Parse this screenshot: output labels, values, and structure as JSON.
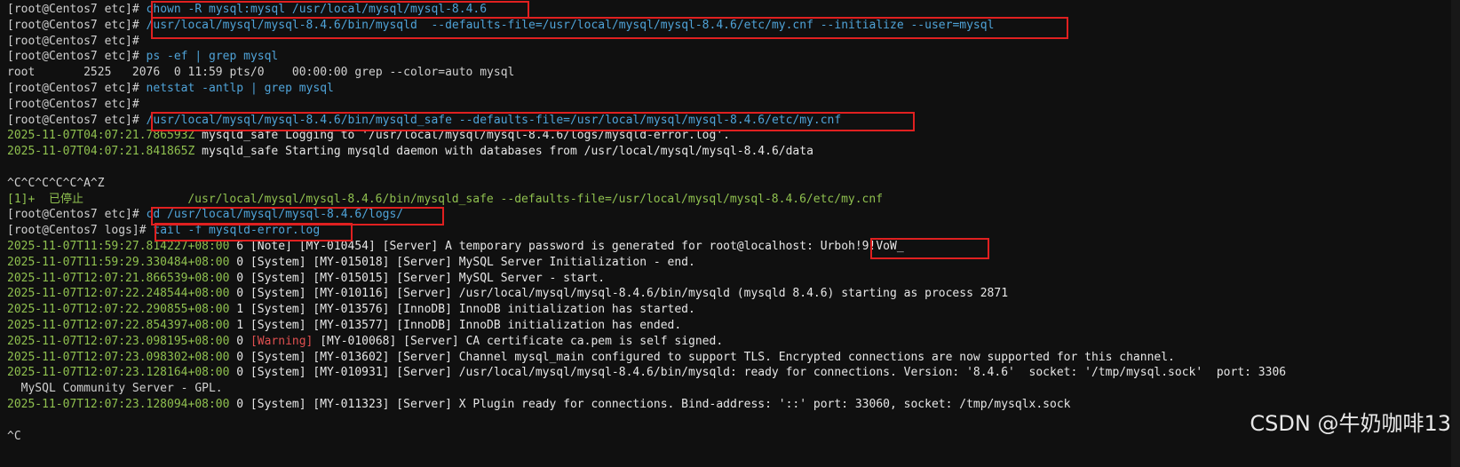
{
  "terminal_lines": [
    {
      "type": "prompt",
      "prompt": "[root@Centos7 etc]# ",
      "cmd": "chown -R mysql:mysql /usr/local/mysql/mysql-8.4.6"
    },
    {
      "type": "prompt",
      "prompt": "[root@Centos7 etc]# ",
      "cmd": "/usr/local/mysql/mysql-8.4.6/bin/mysqld  --defaults-file=/usr/local/mysql/mysql-8.4.6/etc/my.cnf --initialize --user=mysql"
    },
    {
      "type": "prompt",
      "prompt": "[root@Centos7 etc]# ",
      "cmd": ""
    },
    {
      "type": "prompt",
      "prompt": "[root@Centos7 etc]# ",
      "cmd": "ps -ef | grep mysql"
    },
    {
      "type": "plain",
      "text": "root       2525   2076  0 11:59 pts/0    00:00:00 grep --color=auto mysql"
    },
    {
      "type": "prompt",
      "prompt": "[root@Centos7 etc]# ",
      "cmd": "netstat -antlp | grep mysql"
    },
    {
      "type": "prompt",
      "prompt": "[root@Centos7 etc]# ",
      "cmd": ""
    },
    {
      "type": "prompt",
      "prompt": "[root@Centos7 etc]# ",
      "cmd": "/usr/local/mysql/mysql-8.4.6/bin/mysqld_safe --defaults-file=/usr/local/mysql/mysql-8.4.6/etc/my.cnf"
    },
    {
      "type": "log",
      "ts": "2025-11-07T04:07:21.786593Z",
      "text": " mysqld_safe Logging to '/usr/local/mysql/mysql-8.4.6/logs/mysqld-error.log'."
    },
    {
      "type": "log",
      "ts": "2025-11-07T04:07:21.841865Z",
      "text": " mysqld_safe Starting mysqld daemon with databases from /usr/local/mysql/mysql-8.4.6/data"
    },
    {
      "type": "plain",
      "text": ""
    },
    {
      "type": "plain",
      "text": "^C^C^C^C^C^A^Z"
    },
    {
      "type": "job",
      "text": "[1]+  已停止               /usr/local/mysql/mysql-8.4.6/bin/mysqld_safe --defaults-file=/usr/local/mysql/mysql-8.4.6/etc/my.cnf"
    },
    {
      "type": "prompt",
      "prompt": "[root@Centos7 etc]# ",
      "cmd": "cd /usr/local/mysql/mysql-8.4.6/logs/"
    },
    {
      "type": "prompt",
      "prompt": "[root@Centos7 logs]# ",
      "cmd": "tail -f mysqld-error.log"
    },
    {
      "type": "log",
      "ts": "2025-11-07T11:59:27.814227+08:00",
      "text": " 6 [Note] [MY-010454] [Server] A temporary password is generated for root@localhost: Urboh!9!VoW_"
    },
    {
      "type": "log",
      "ts": "2025-11-07T11:59:29.330484+08:00",
      "text": " 0 [System] [MY-015018] [Server] MySQL Server Initialization - end."
    },
    {
      "type": "log",
      "ts": "2025-11-07T12:07:21.866539+08:00",
      "text": " 0 [System] [MY-015015] [Server] MySQL Server - start."
    },
    {
      "type": "log",
      "ts": "2025-11-07T12:07:22.248544+08:00",
      "text": " 0 [System] [MY-010116] [Server] /usr/local/mysql/mysql-8.4.6/bin/mysqld (mysqld 8.4.6) starting as process 2871"
    },
    {
      "type": "log",
      "ts": "2025-11-07T12:07:22.290855+08:00",
      "text": " 1 [System] [MY-013576] [InnoDB] InnoDB initialization has started."
    },
    {
      "type": "log",
      "ts": "2025-11-07T12:07:22.854397+08:00",
      "text": " 1 [System] [MY-013577] [InnoDB] InnoDB initialization has ended."
    },
    {
      "type": "log",
      "ts": "2025-11-07T12:07:23.098195+08:00",
      "text": " 0 [Warning] [MY-010068] [Server] CA certificate ca.pem is self signed."
    },
    {
      "type": "log",
      "ts": "2025-11-07T12:07:23.098302+08:00",
      "text": " 0 [System] [MY-013602] [Server] Channel mysql_main configured to support TLS. Encrypted connections are now supported for this channel."
    },
    {
      "type": "log",
      "ts": "2025-11-07T12:07:23.128164+08:00",
      "text": " 0 [System] [MY-010931] [Server] /usr/local/mysql/mysql-8.4.6/bin/mysqld: ready for connections. Version: '8.4.6'  socket: '/tmp/mysql.sock'  port: 3306"
    },
    {
      "type": "plain",
      "text": "  MySQL Community Server - GPL."
    },
    {
      "type": "log",
      "ts": "2025-11-07T12:07:23.128094+08:00",
      "text": " 0 [System] [MY-011323] [Server] X Plugin ready for connections. Bind-address: '::' port: 33060, socket: /tmp/mysqlx.sock"
    },
    {
      "type": "plain",
      "text": ""
    },
    {
      "type": "plain",
      "text": "^C"
    }
  ],
  "watermark": "CSDN @牛奶咖啡13"
}
